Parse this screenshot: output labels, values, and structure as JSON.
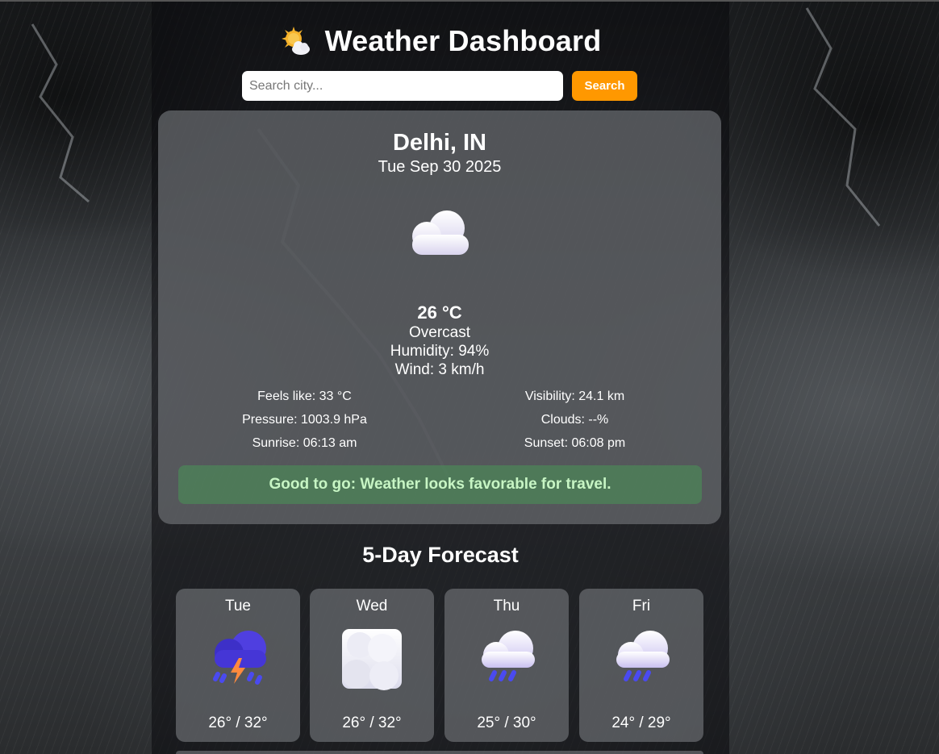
{
  "app": {
    "title": "Weather Dashboard",
    "icon": "sun-behind-cloud-icon"
  },
  "search": {
    "placeholder": "Search city...",
    "value": "",
    "button_label": "Search"
  },
  "current": {
    "city": "Delhi, IN",
    "date": "Tue Sep 30 2025",
    "icon": "cloud-icon",
    "temperature": "26 °C",
    "condition": "Overcast",
    "humidity": "Humidity: 94%",
    "wind": "Wind: 3 km/h",
    "details": {
      "feels_like": "Feels like: 33 °C",
      "visibility": "Visibility: 24.1 km",
      "pressure": "Pressure: 1003.9 hPa",
      "clouds": "Clouds: --%",
      "sunrise": "Sunrise: 06:13 am",
      "sunset": "Sunset: 06:08 pm"
    },
    "advice": "Good to go: Weather looks favorable for travel."
  },
  "forecast": {
    "title": "5-Day Forecast",
    "days": [
      {
        "day": "Tue",
        "icon": "thunderstorm-icon",
        "temps": "26° / 32°"
      },
      {
        "day": "Wed",
        "icon": "overcast-clouds-icon",
        "temps": "26° / 32°"
      },
      {
        "day": "Thu",
        "icon": "rain-cloud-icon",
        "temps": "25° / 30°"
      },
      {
        "day": "Fri",
        "icon": "rain-cloud-icon",
        "temps": "24° / 29°"
      }
    ]
  },
  "colors": {
    "accent": "#ff9800",
    "advice_bg": "#4c8c58",
    "advice_text": "#c7f5c4"
  }
}
